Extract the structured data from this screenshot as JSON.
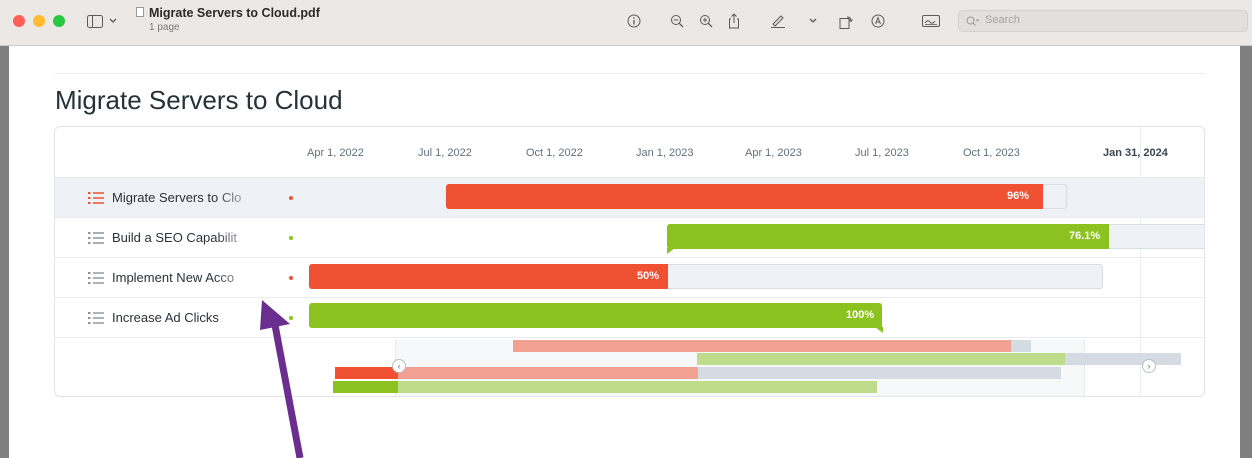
{
  "window": {
    "doc_title": "Migrate Servers to Cloud.pdf",
    "doc_subtitle": "1 page",
    "search_placeholder": "Search",
    "icons": [
      "sidebar-toggle-icon",
      "chevron-down-icon",
      "info-icon",
      "zoom-out-icon",
      "zoom-in-icon",
      "share-icon",
      "markup-pen-icon",
      "chevron-down-icon",
      "rotate-icon",
      "markup-circle-icon",
      "signature-icon",
      "search-icon"
    ]
  },
  "page": {
    "title": "Migrate Servers to Cloud"
  },
  "gantt": {
    "axis": [
      "Apr 1, 2022",
      "Jul 1, 2022",
      "Oct 1, 2022",
      "Jan 1, 2023",
      "Apr 1, 2023",
      "Jul 1, 2023",
      "Oct 1, 2023",
      "Jan 31, 2024"
    ],
    "rows": [
      {
        "label": "Migrate Servers to Clo",
        "status_color": "#f05133",
        "progress_label": "96%",
        "progress": 0.96,
        "selected": true
      },
      {
        "label": "Build a SEO Capabilit",
        "status_color": "#8cc21f",
        "progress_label": "76.1%",
        "progress": 0.761,
        "selected": false
      },
      {
        "label": "Implement New Acco",
        "status_color": "#f05133",
        "progress_label": "50%",
        "progress": 0.5,
        "selected": false
      },
      {
        "label": "Increase Ad Clicks",
        "status_color": "#8cc21f",
        "progress_label": "100%",
        "progress": 1.0,
        "selected": false
      }
    ],
    "colors": {
      "red": "#f05133",
      "green": "#8cc21f",
      "red_light": "#f2a091",
      "green_light": "#bfdc8c",
      "track": "#eef1f5"
    }
  },
  "annotation": {
    "arrow_color": "#6b2d8f"
  }
}
